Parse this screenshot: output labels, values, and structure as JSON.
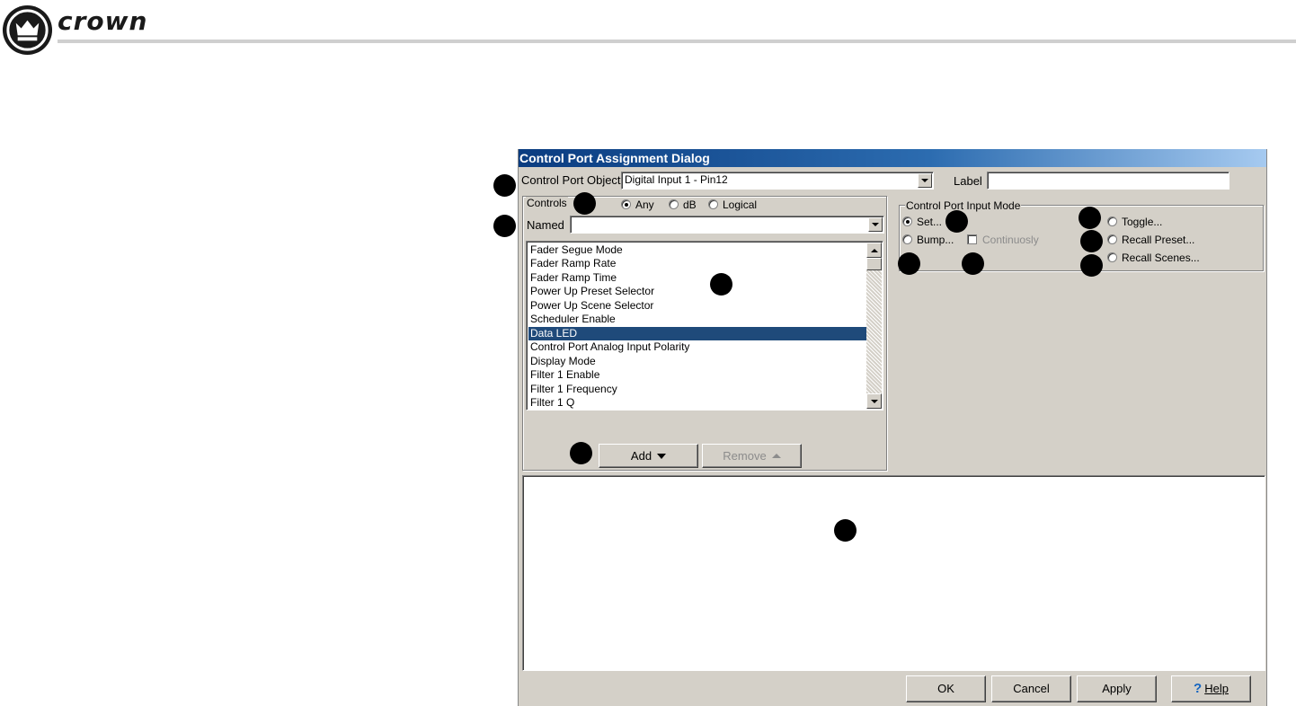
{
  "brand": {
    "name": "crown"
  },
  "dialog": {
    "title": "Control Port Assignment Dialog",
    "control_port_object": {
      "label": "Control Port Object",
      "value": "Digital Input 1 - Pin12"
    },
    "label_field": {
      "label": "Label",
      "value": ""
    },
    "controls": {
      "group_title": "Controls",
      "filters": [
        {
          "label": "Any",
          "checked": true
        },
        {
          "label": "dB",
          "checked": false
        },
        {
          "label": "Logical",
          "checked": false
        }
      ],
      "named": {
        "label": "Named",
        "value": ""
      },
      "items": [
        "Fader Segue Mode",
        "Fader Ramp Rate",
        "Fader Ramp Time",
        "Power Up Preset Selector",
        "Power Up Scene Selector",
        "Scheduler Enable",
        "Data LED",
        "Control Port Analog Input Polarity",
        "Display Mode",
        "Filter 1 Enable",
        "Filter 1 Frequency",
        "Filter 1 Q"
      ],
      "selected_item": "Data LED",
      "add_label": "Add",
      "remove_label": "Remove"
    },
    "input_mode": {
      "group_title": "Control Port Input Mode",
      "set": {
        "label": "Set...",
        "checked": true
      },
      "bump": {
        "label": "Bump...",
        "checked": false
      },
      "continuously": {
        "label": "Continuosly",
        "checked": false
      },
      "toggle": {
        "label": "Toggle...",
        "checked": false
      },
      "recall_preset": {
        "label": "Recall Preset...",
        "checked": false
      },
      "recall_scenes": {
        "label": "Recall Scenes...",
        "checked": false
      }
    },
    "assignments_text": "",
    "buttons": {
      "ok": "OK",
      "cancel": "Cancel",
      "apply": "Apply",
      "help": "Help",
      "help_glyph": "?"
    }
  },
  "colors": {
    "dialog_bg": "#d4d0c8",
    "titlebar_start": "#0a3c80",
    "titlebar_end": "#a6caf0",
    "selection": "#1f4a7a",
    "help_icon": "#1565c0"
  },
  "icons": [
    "crown-logo-icon",
    "dropdown-arrow-icon",
    "scroll-up-icon",
    "scroll-down-icon",
    "help-question-icon",
    "callout-marker-icon"
  ]
}
